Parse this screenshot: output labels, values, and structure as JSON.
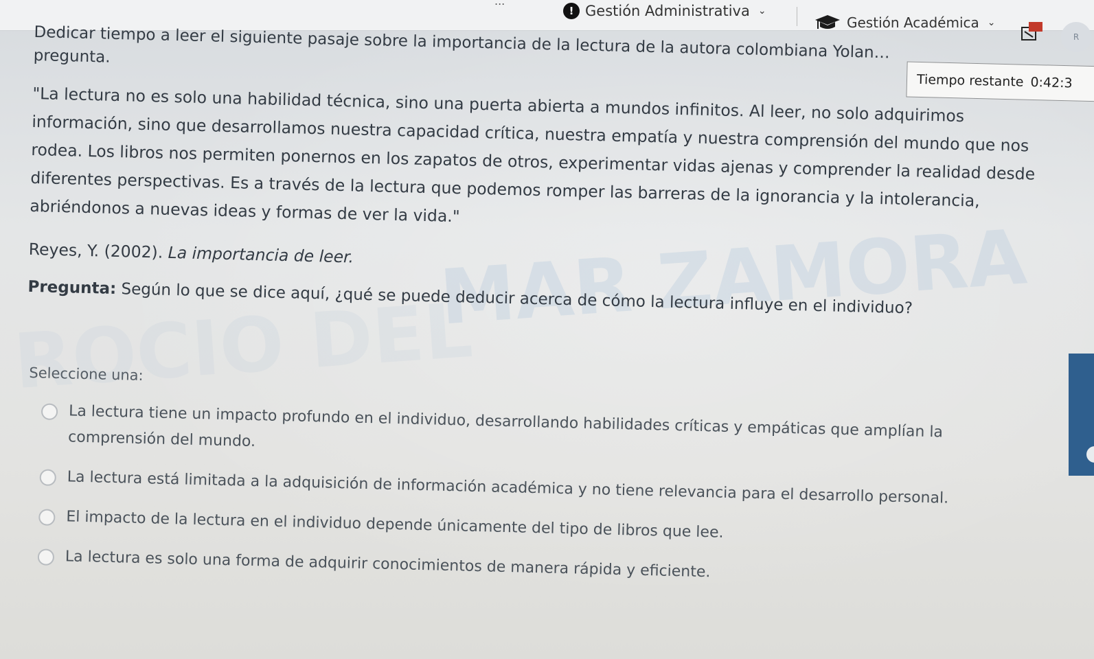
{
  "nav": {
    "cut_item": "...",
    "admin_label": "Gestión Administrativa",
    "acad_label": "Gestión Académica",
    "avatar_text": "R"
  },
  "timer": {
    "label": "Tiempo restante",
    "value": "0:42:3"
  },
  "content": {
    "intro": "Dedicar tiempo a leer el siguiente pasaje sobre la importancia de la lectura de la autora colombiana Yolan… pregunta.",
    "passage": "\"La lectura no es solo una habilidad técnica, sino una puerta abierta a mundos infinitos. Al leer, no solo adquirimos información, sino que desarrollamos nuestra capacidad crítica, nuestra empatía y nuestra comprensión del mundo que nos rodea. Los libros nos permiten ponernos en los zapatos de otros, experimentar vidas ajenas y comprender la realidad desde diferentes perspectivas. Es a través de la lectura que podemos romper las barreras de la ignorancia y la intolerancia, abriéndonos a nuevas ideas y formas de ver la vida.\"",
    "citation_author": "Reyes, Y. (2002).",
    "citation_title": "La importancia de leer.",
    "question_label": "Pregunta:",
    "question_text": "Según lo que se dice aquí, ¿qué se puede deducir acerca de cómo la lectura influye en el individuo?",
    "select_label": "Seleccione una:",
    "options": [
      "La lectura tiene un impacto profundo en el individuo, desarrollando habilidades críticas y empáticas que amplían la comprensión del mundo.",
      "La lectura está limitada a la adquisición de información académica y no tiene relevancia para el desarrollo personal.",
      "El impacto de la lectura en el individuo depende únicamente del tipo de libros que lee.",
      "La lectura es solo una forma de adquirir conocimientos de manera rápida y eficiente."
    ]
  },
  "watermark": {
    "line1": "MAR ZAMORA",
    "line2": "ROCIO DEL"
  },
  "icons": {
    "info": "info-icon",
    "graduation": "graduation-cap-icon",
    "apps": "apps-grid-icon"
  }
}
